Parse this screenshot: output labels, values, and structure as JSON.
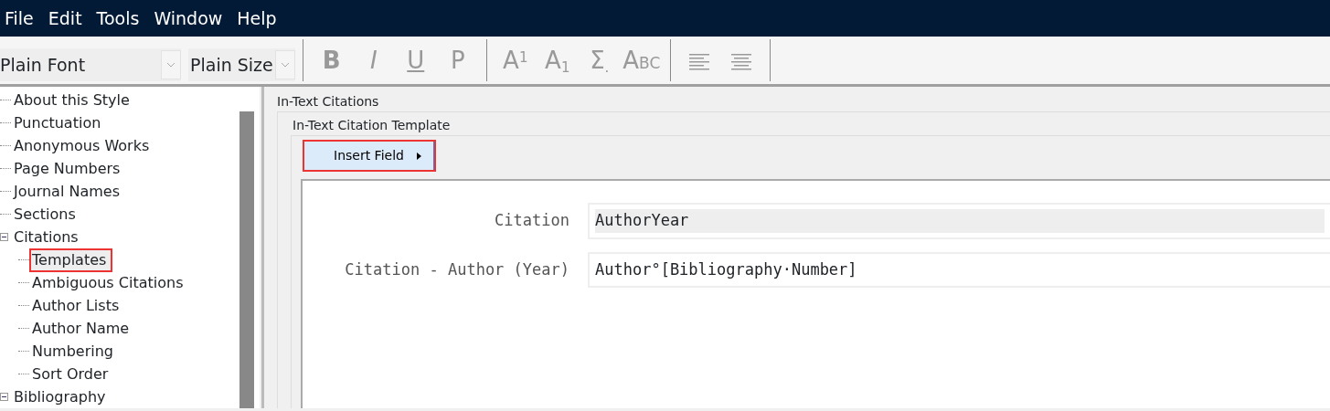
{
  "menu": [
    "File",
    "Edit",
    "Tools",
    "Window",
    "Help"
  ],
  "toolbar": {
    "font": "Plain Font",
    "size": "Plain Size",
    "groups": [
      [
        {
          "kind": "bold",
          "label": "B"
        },
        {
          "kind": "italic",
          "label": "I"
        },
        {
          "kind": "underline",
          "label": "U"
        },
        {
          "kind": "plain",
          "label": "P"
        }
      ],
      [
        {
          "kind": "superscript",
          "label": "A",
          "sub": "1"
        },
        {
          "kind": "subscript",
          "label": "A",
          "sub": "1"
        },
        {
          "kind": "symbol",
          "label": "Σ",
          "sub": "."
        },
        {
          "kind": "smallcaps",
          "label": "A",
          "sub": "BC"
        }
      ],
      [
        {
          "kind": "align-left"
        },
        {
          "kind": "align-center"
        }
      ]
    ]
  },
  "tree": [
    {
      "label": "About this Style",
      "selected": false
    },
    {
      "label": "Punctuation",
      "selected": false
    },
    {
      "label": "Anonymous Works",
      "selected": false
    },
    {
      "label": "Page Numbers",
      "selected": false
    },
    {
      "label": "Journal Names",
      "selected": false
    },
    {
      "label": "Sections",
      "selected": false
    },
    {
      "label": "Citations",
      "selected": false,
      "expanded": true,
      "children": [
        {
          "label": "Templates",
          "selected": true,
          "highlighted": true
        },
        {
          "label": "Ambiguous Citations",
          "selected": false
        },
        {
          "label": "Author Lists",
          "selected": false
        },
        {
          "label": "Author Name",
          "selected": false
        },
        {
          "label": "Numbering",
          "selected": false
        },
        {
          "label": "Sort Order",
          "selected": false
        }
      ]
    },
    {
      "label": "Bibliography",
      "selected": false,
      "expanded": true
    }
  ],
  "panel": {
    "group_title": "In-Text Citations",
    "subgroup_title": "In-Text Citation Template",
    "insert_button": {
      "label": "Insert Field",
      "highlighted": true
    },
    "rows": [
      {
        "label": "Citation",
        "value": "AuthorYear",
        "selected": true
      },
      {
        "label": "Citation - Author (Year)",
        "value": "Author°[Bibliography·Number]",
        "selected": false
      }
    ]
  }
}
